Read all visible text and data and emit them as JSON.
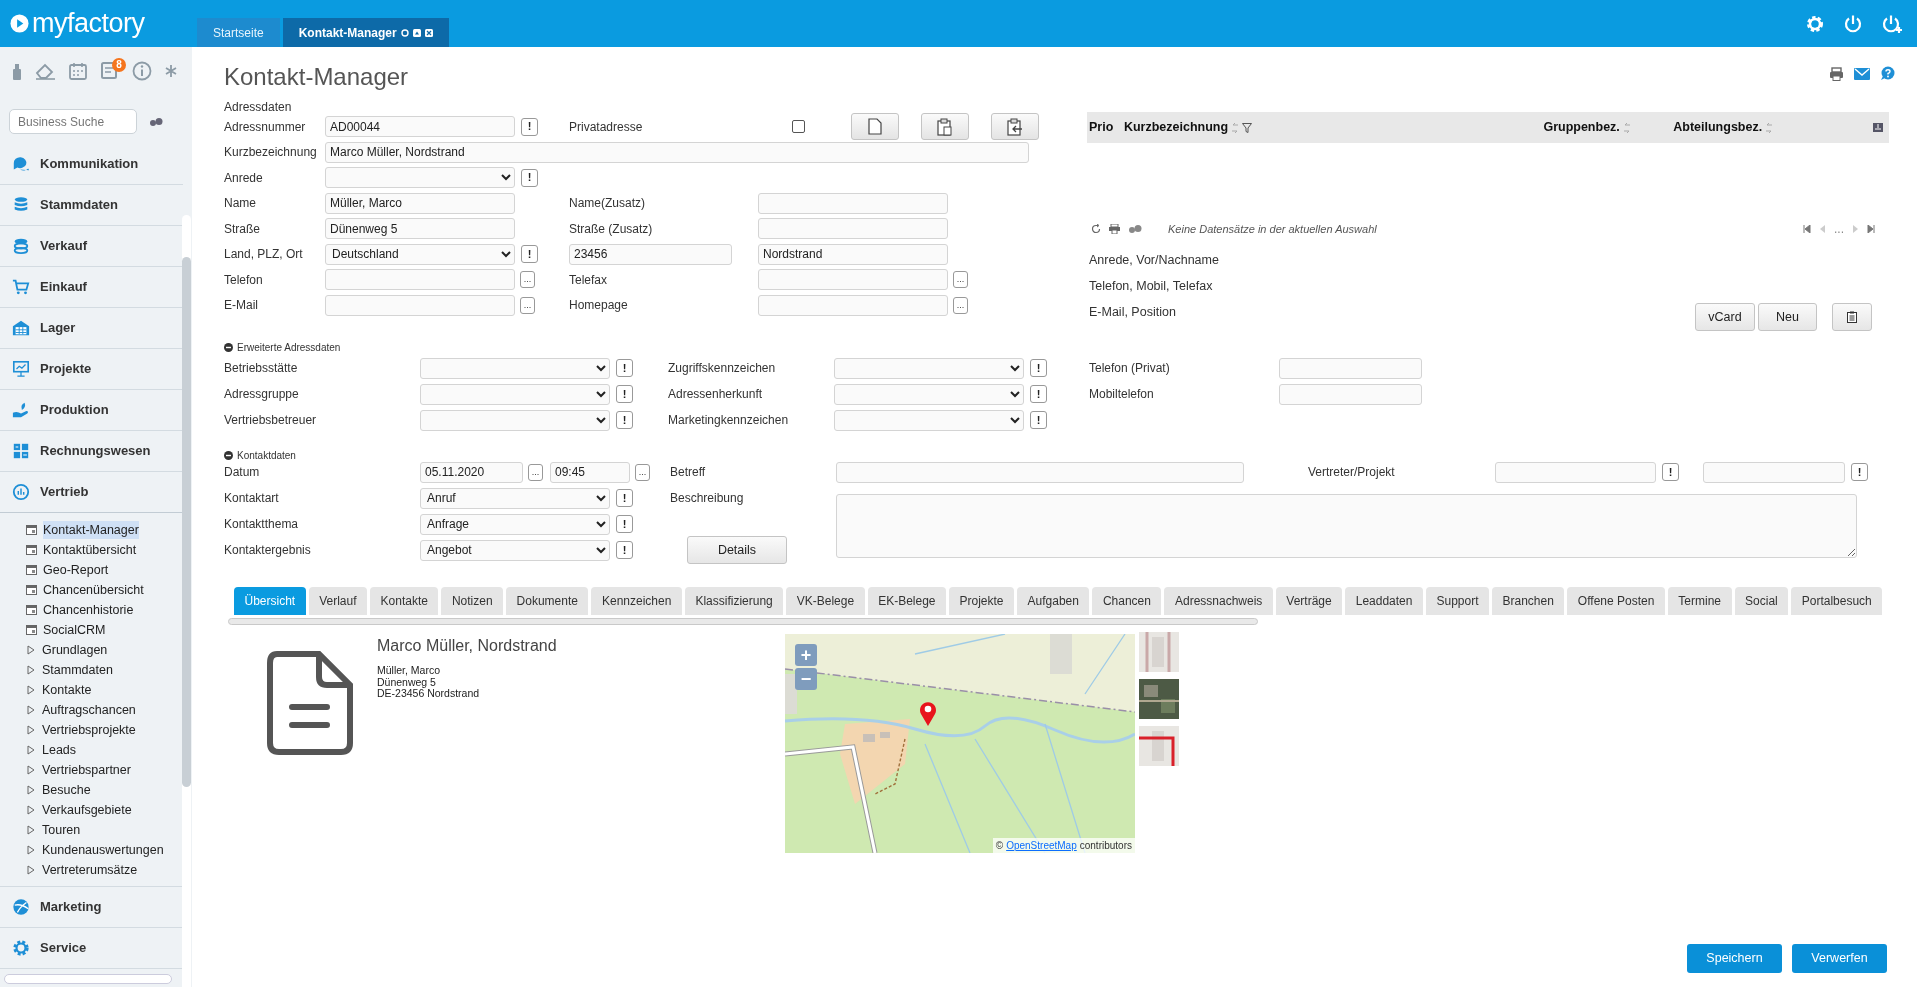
{
  "header": {
    "logo": "myfactory",
    "tabs": [
      {
        "label": "Startseite",
        "selected": false
      },
      {
        "label": "Kontakt-Manager",
        "selected": true
      }
    ]
  },
  "sidebar": {
    "badge": "8",
    "search": {
      "placeholder": "Business Suche"
    },
    "sections": [
      {
        "label": "Kommunikation",
        "expanded": false
      },
      {
        "label": "Stammdaten",
        "expanded": false
      },
      {
        "label": "Verkauf",
        "expanded": false
      },
      {
        "label": "Einkauf",
        "expanded": false
      },
      {
        "label": "Lager",
        "expanded": false
      },
      {
        "label": "Projekte",
        "expanded": false
      },
      {
        "label": "Produktion",
        "expanded": false
      },
      {
        "label": "Rechnungswesen",
        "expanded": false
      },
      {
        "label": "Vertrieb",
        "expanded": true,
        "children": [
          {
            "label": "Kontakt-Manager",
            "kind": "page",
            "selected": true
          },
          {
            "label": "Kontaktübersicht",
            "kind": "page",
            "selected": false
          },
          {
            "label": "Geo-Report",
            "kind": "page",
            "selected": false
          },
          {
            "label": "Chancenübersicht",
            "kind": "page",
            "selected": false
          },
          {
            "label": "Chancenhistorie",
            "kind": "page",
            "selected": false
          },
          {
            "label": "SocialCRM",
            "kind": "page",
            "selected": false
          },
          {
            "label": "Grundlagen",
            "kind": "folder",
            "selected": false
          },
          {
            "label": "Stammdaten",
            "kind": "folder",
            "selected": false
          },
          {
            "label": "Kontakte",
            "kind": "folder",
            "selected": false
          },
          {
            "label": "Auftragschancen",
            "kind": "folder",
            "selected": false
          },
          {
            "label": "Vertriebsprojekte",
            "kind": "folder",
            "selected": false
          },
          {
            "label": "Leads",
            "kind": "folder",
            "selected": false
          },
          {
            "label": "Vertriebspartner",
            "kind": "folder",
            "selected": false
          },
          {
            "label": "Besuche",
            "kind": "folder",
            "selected": false
          },
          {
            "label": "Verkaufsgebiete",
            "kind": "folder",
            "selected": false
          },
          {
            "label": "Touren",
            "kind": "folder",
            "selected": false
          },
          {
            "label": "Kundenauswertungen",
            "kind": "folder",
            "selected": false
          },
          {
            "label": "Vertreterumsätze",
            "kind": "folder",
            "selected": false
          }
        ]
      },
      {
        "label": "Marketing",
        "expanded": false
      },
      {
        "label": "Service",
        "expanded": false
      }
    ]
  },
  "page": {
    "title": "Kontakt-Manager"
  },
  "address": {
    "heading": "Adressdaten",
    "rows": [
      {
        "label": "Adressnummer",
        "field": {
          "kind": "input",
          "value": "AD00044",
          "button": "!"
        },
        "label2": "Privatadresse",
        "field2": {
          "kind": "checkbox",
          "checked": false
        }
      },
      {
        "label": "Kurzbezeichnung",
        "field": {
          "kind": "wide",
          "value": "Marco Müller, Nordstrand"
        }
      },
      {
        "label": "Anrede",
        "field": {
          "kind": "select",
          "button": "!"
        }
      },
      {
        "label": "Name",
        "field": {
          "kind": "input",
          "value": "Müller, Marco"
        },
        "label2": "Name(Zusatz)",
        "field2": {
          "kind": "input"
        }
      },
      {
        "label": "Straße",
        "field": {
          "kind": "input",
          "value": "Dünenweg 5"
        },
        "label2": "Straße (Zusatz)",
        "field2": {
          "kind": "input"
        }
      },
      {
        "label": "Land, PLZ, Ort",
        "field": {
          "kind": "select",
          "value": "Deutschland",
          "button": "!"
        },
        "field_mid": {
          "kind": "input",
          "value": "23456"
        },
        "field2": {
          "kind": "input",
          "value": "Nordstrand"
        }
      },
      {
        "label": "Telefon",
        "field": {
          "kind": "input",
          "button": "..."
        },
        "label2": "Telefax",
        "field2": {
          "kind": "input",
          "button": "..."
        }
      },
      {
        "label": "E-Mail",
        "field": {
          "kind": "input",
          "button": "..."
        },
        "label2": "Homepage",
        "field2": {
          "kind": "input",
          "button": "..."
        }
      }
    ]
  },
  "contacts_panel": {
    "columns": [
      {
        "label": "Prio",
        "sortable": false,
        "filter": false
      },
      {
        "label": "Kurzbezeichnung",
        "sortable": true,
        "filter": true
      },
      {
        "label": "Gruppenbez.",
        "sortable": true,
        "filter": false
      },
      {
        "label": "Abteilungsbez.",
        "sortable": true,
        "filter": false
      }
    ],
    "status": "Keine Datensätze in der aktuellen Auswahl",
    "pager_ellipsis": "...",
    "details": [
      "Anrede, Vor/Nachname",
      "Telefon, Mobil, Telefax",
      "E-Mail, Position"
    ],
    "buttons": [
      "vCard",
      "Neu"
    ]
  },
  "extended": {
    "heading": "Erweiterte Adressdaten",
    "expanded": true,
    "rows": [
      {
        "label": "Betriebsstätte",
        "field": {
          "kind": "select",
          "button": "!"
        },
        "label2": "Zugriffskennzeichen",
        "field2": {
          "kind": "select",
          "button": "!"
        },
        "label3": "Telefon (Privat)",
        "field3": {
          "kind": "input"
        }
      },
      {
        "label": "Adressgruppe",
        "field": {
          "kind": "select",
          "button": "!"
        },
        "label2": "Adressenherkunft",
        "field2": {
          "kind": "select",
          "button": "!"
        },
        "label3": "Mobiltelefon",
        "field3": {
          "kind": "input"
        }
      },
      {
        "label": "Vertriebsbetreuer",
        "field": {
          "kind": "select",
          "button": "!"
        },
        "label2": "Marketingkennzeichen",
        "field2": {
          "kind": "select",
          "button": "!"
        }
      }
    ]
  },
  "contact": {
    "heading": "Kontaktdaten",
    "expanded": true,
    "rows": [
      {
        "label": "Datum",
        "field": {
          "kind": "datetime",
          "date": "05.11.2020",
          "time": "09:45",
          "button": "..."
        },
        "label2": "Betreff",
        "field2": {
          "kind": "input"
        },
        "label3": "Vertreter/Projekt",
        "field3": {
          "kind": "pair",
          "button": "!"
        }
      },
      {
        "label": "Kontaktart",
        "field": {
          "kind": "select",
          "value": "Anruf",
          "button": "!"
        },
        "label2": "Beschreibung",
        "field2": {
          "kind": "textarea"
        }
      },
      {
        "label": "Kontaktthema",
        "field": {
          "kind": "select",
          "value": "Anfrage",
          "button": "!"
        }
      },
      {
        "label": "Kontaktergebnis",
        "field": {
          "kind": "select",
          "value": "Angebot",
          "button": "!"
        },
        "action": "Details"
      }
    ]
  },
  "detail_tabs": [
    {
      "label": "Übersicht",
      "selected": true
    },
    {
      "label": "Verlauf",
      "selected": false
    },
    {
      "label": "Kontakte",
      "selected": false
    },
    {
      "label": "Notizen",
      "selected": false
    },
    {
      "label": "Dokumente",
      "selected": false
    },
    {
      "label": "Kennzeichen",
      "selected": false
    },
    {
      "label": "Klassifizierung",
      "selected": false
    },
    {
      "label": "VK-Belege",
      "selected": false
    },
    {
      "label": "EK-Belege",
      "selected": false
    },
    {
      "label": "Projekte",
      "selected": false
    },
    {
      "label": "Aufgaben",
      "selected": false
    },
    {
      "label": "Chancen",
      "selected": false
    },
    {
      "label": "Adressnachweis",
      "selected": false
    },
    {
      "label": "Verträge",
      "selected": false
    },
    {
      "label": "Leaddaten",
      "selected": false
    },
    {
      "label": "Support",
      "selected": false
    },
    {
      "label": "Branchen",
      "selected": false
    },
    {
      "label": "Offene Posten",
      "selected": false
    },
    {
      "label": "Termine",
      "selected": false
    },
    {
      "label": "Social",
      "selected": false
    },
    {
      "label": "Portalbesuch",
      "selected": false
    }
  ],
  "overview": {
    "title": "Marco Müller, Nordstrand",
    "lines": [
      "Müller, Marco",
      "Dünenweg 5",
      "DE-23456 Nordstrand"
    ],
    "map": {
      "kind": "picture",
      "zoom_in": "+",
      "zoom_out": "−",
      "attribution_prefix": "©",
      "attribution_link": "OpenStreetMap",
      "attribution_suffix": "contributors"
    },
    "thumbnails": [
      {
        "kind": "picture"
      },
      {
        "kind": "picture"
      },
      {
        "kind": "picture"
      }
    ]
  },
  "footer": {
    "buttons": [
      "Speichern",
      "Verwerfen"
    ]
  }
}
